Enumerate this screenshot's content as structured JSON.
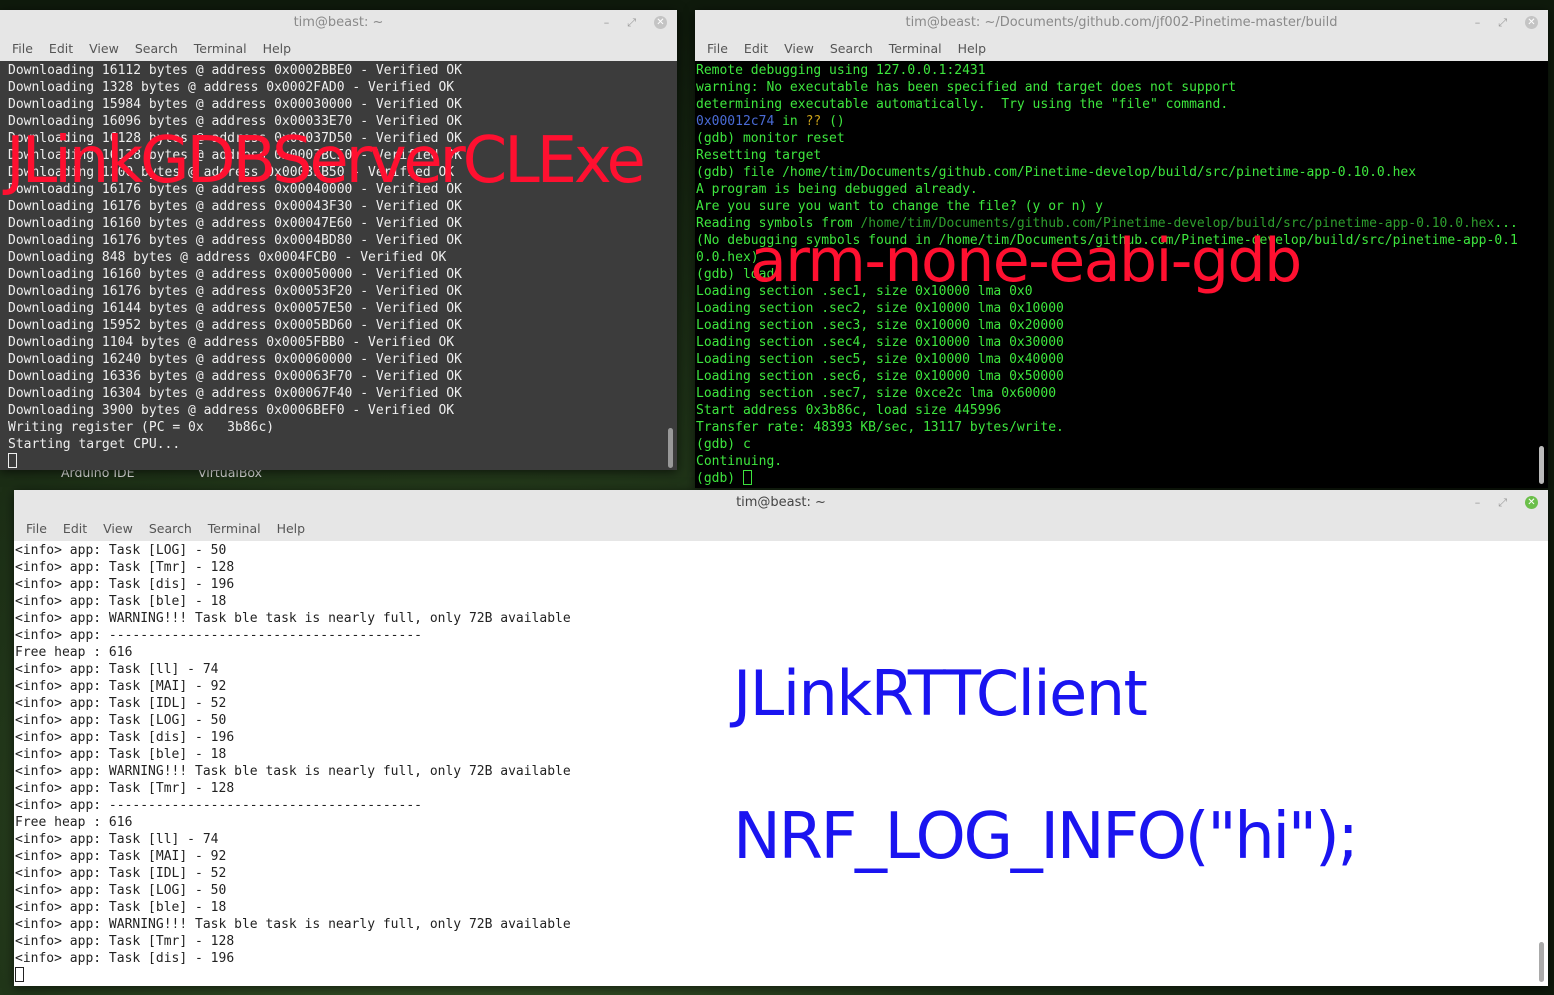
{
  "desktop": {
    "icons": [
      "Arduino IDE",
      "VirtualBox"
    ]
  },
  "menu": [
    "File",
    "Edit",
    "View",
    "Search",
    "Terminal",
    "Help"
  ],
  "colors": {
    "overlay_red": "#ff1030",
    "overlay_blue": "#1a14f0",
    "gdb_green": "#3ee63e",
    "gdb_addr": "#4a6bd6",
    "gdb_q": "#c8a018",
    "gdb_dim": "#2e9e2e"
  },
  "left_terminal": {
    "title": "tim@beast: ~",
    "lines": [
      "Downloading 16112 bytes @ address 0x0002BBE0 - Verified OK",
      "Downloading 1328 bytes @ address 0x0002FAD0 - Verified OK",
      "Downloading 15984 bytes @ address 0x00030000 - Verified OK",
      "Downloading 16096 bytes @ address 0x00033E70 - Verified OK",
      "Downloading 16128 bytes @ address 0x00037D50 - Verified OK",
      "Downloading 16128 bytes @ address 0x0003BC50 - Verified OK",
      "Downloading 1200 bytes @ address 0x0003FB50 - Verified OK",
      "Downloading 16176 bytes @ address 0x00040000 - Verified OK",
      "Downloading 16176 bytes @ address 0x00043F30 - Verified OK",
      "Downloading 16160 bytes @ address 0x00047E60 - Verified OK",
      "Downloading 16176 bytes @ address 0x0004BD80 - Verified OK",
      "Downloading 848 bytes @ address 0x0004FCB0 - Verified OK",
      "Downloading 16160 bytes @ address 0x00050000 - Verified OK",
      "Downloading 16176 bytes @ address 0x00053F20 - Verified OK",
      "Downloading 16144 bytes @ address 0x00057E50 - Verified OK",
      "Downloading 15952 bytes @ address 0x0005BD60 - Verified OK",
      "Downloading 1104 bytes @ address 0x0005FBB0 - Verified OK",
      "Downloading 16240 bytes @ address 0x00060000 - Verified OK",
      "Downloading 16336 bytes @ address 0x00063F70 - Verified OK",
      "Downloading 16304 bytes @ address 0x00067F40 - Verified OK",
      "Downloading 3900 bytes @ address 0x0006BEF0 - Verified OK",
      "Writing register (PC = 0x   3b86c)",
      "Starting target CPU..."
    ],
    "overlay": "JLinkGDBServerCLExe"
  },
  "right_terminal": {
    "title": "tim@beast: ~/Documents/github.com/jf002-Pinetime-master/build",
    "lines": [
      [
        [
          "Remote debugging using 127.0.0.1:2431",
          "g"
        ]
      ],
      [
        [
          "warning: No executable has been specified and target does not support",
          "g"
        ]
      ],
      [
        [
          "determining executable automatically.  Try using the \"file\" command.",
          "g"
        ]
      ],
      [
        [
          "0x00012c74",
          "a"
        ],
        [
          " in ",
          "g"
        ],
        [
          "??",
          "q"
        ],
        [
          " ()",
          "g"
        ]
      ],
      [
        [
          "(gdb) monitor reset",
          "g"
        ]
      ],
      [
        [
          "Resetting target",
          "g"
        ]
      ],
      [
        [
          "(gdb) file /home/tim/Documents/github.com/Pinetime-develop/build/src/pinetime-app-0.10.0.hex",
          "g"
        ]
      ],
      [
        [
          "A program is being debugged already.",
          "g"
        ]
      ],
      [
        [
          "Are you sure you want to change the file? (y or n) y",
          "g"
        ]
      ],
      [
        [
          "Reading symbols from ",
          "g"
        ],
        [
          "/home/tim/Documents/github.com/Pinetime-develop/build/src/pinetime-app-0.10.0.hex",
          "d"
        ],
        [
          "...",
          "g"
        ]
      ],
      [
        [
          "(No debugging symbols found in /home/tim/Documents/github.com/Pinetime-develop/build/src/pinetime-app-0.1",
          "g"
        ]
      ],
      [
        [
          "0.0.hex)",
          "g"
        ]
      ],
      [
        [
          "(gdb) load",
          "g"
        ]
      ],
      [
        [
          "Loading section .sec1, size 0x10000 lma 0x0",
          "g"
        ]
      ],
      [
        [
          "Loading section .sec2, size 0x10000 lma 0x10000",
          "g"
        ]
      ],
      [
        [
          "Loading section .sec3, size 0x10000 lma 0x20000",
          "g"
        ]
      ],
      [
        [
          "Loading section .sec4, size 0x10000 lma 0x30000",
          "g"
        ]
      ],
      [
        [
          "Loading section .sec5, size 0x10000 lma 0x40000",
          "g"
        ]
      ],
      [
        [
          "Loading section .sec6, size 0x10000 lma 0x50000",
          "g"
        ]
      ],
      [
        [
          "Loading section .sec7, size 0xce2c lma 0x60000",
          "g"
        ]
      ],
      [
        [
          "Start address 0x3b86c, load size 445996",
          "g"
        ]
      ],
      [
        [
          "Transfer rate: 48393 KB/sec, 13117 bytes/write.",
          "g"
        ]
      ],
      [
        [
          "(gdb) c",
          "g"
        ]
      ],
      [
        [
          "Continuing.",
          "g"
        ]
      ]
    ],
    "prompt": "(gdb) ",
    "overlay": "arm-none-eabi-gdb"
  },
  "bottom_terminal": {
    "title": "tim@beast: ~",
    "lines": [
      "<info> app: Task [LOG] - 50",
      "<info> app: Task [Tmr] - 128",
      "<info> app: Task [dis] - 196",
      "<info> app: Task [ble] - 18",
      "<info> app: WARNING!!! Task ble task is nearly full, only 72B available",
      "<info> app: ----------------------------------------",
      "Free heap : 616",
      "<info> app: Task [ll] - 74",
      "<info> app: Task [MAI] - 92",
      "<info> app: Task [IDL] - 52",
      "<info> app: Task [LOG] - 50",
      "<info> app: Task [dis] - 196",
      "<info> app: Task [ble] - 18",
      "<info> app: WARNING!!! Task ble task is nearly full, only 72B available",
      "<info> app: Task [Tmr] - 128",
      "<info> app: ----------------------------------------",
      "Free heap : 616",
      "<info> app: Task [ll] - 74",
      "<info> app: Task [MAI] - 92",
      "<info> app: Task [IDL] - 52",
      "<info> app: Task [LOG] - 50",
      "<info> app: Task [ble] - 18",
      "<info> app: WARNING!!! Task ble task is nearly full, only 72B available",
      "<info> app: Task [Tmr] - 128",
      "<info> app: Task [dis] - 196"
    ],
    "overlay_1": "JLinkRTTClient",
    "overlay_2": "NRF_LOG_INFO(\"hi\");"
  }
}
